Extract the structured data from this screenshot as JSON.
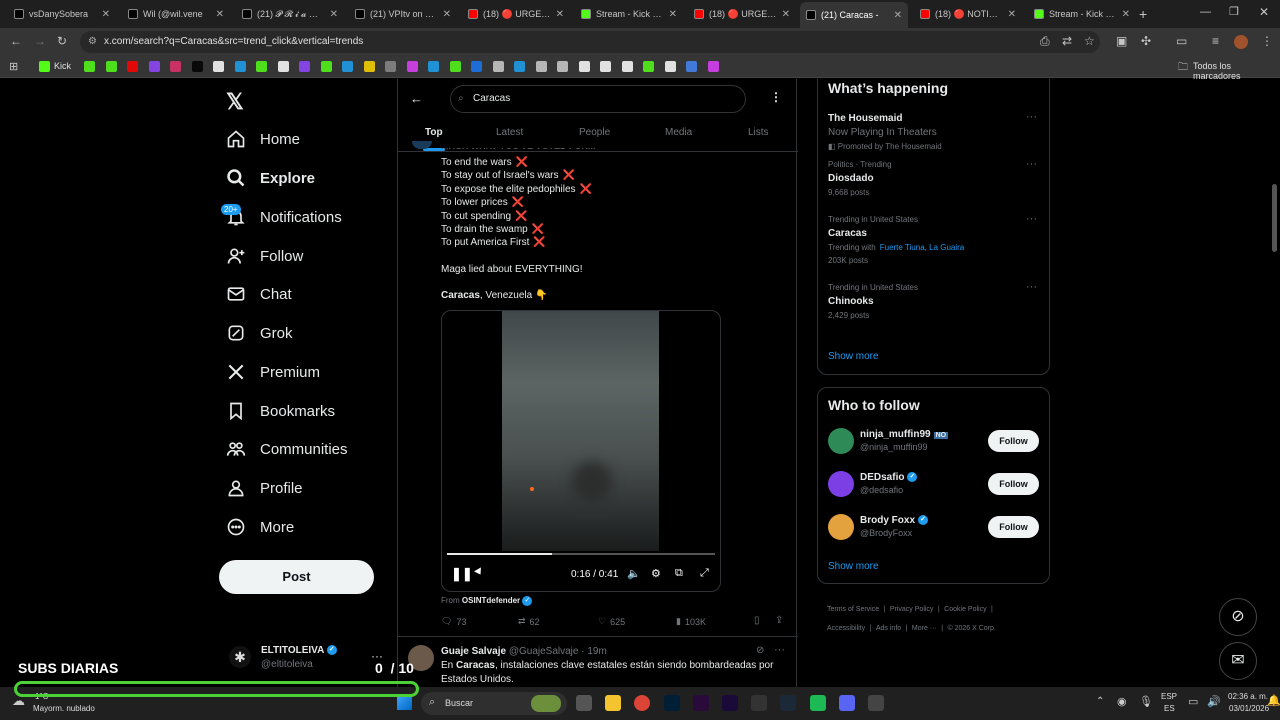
{
  "tabs": [
    {
      "title": "vsDanySobera",
      "color": "#000000",
      "icon": "tiktok-icon"
    },
    {
      "title": "Wil (@wil.vene",
      "color": "#000000",
      "icon": "tiktok-icon"
    },
    {
      "title": "(21) 𝓟 𝓡 𝓲 𝓪 ❤ on",
      "color": "#000000",
      "icon": "x-icon"
    },
    {
      "title": "(21) VPItv on X: \"A",
      "color": "#000000",
      "icon": "x-icon"
    },
    {
      "title": "(18) 🔴 URGENTE",
      "color": "#ff0000",
      "icon": "youtube-icon"
    },
    {
      "title": "Stream - Kick Dash",
      "color": "#53fc18",
      "icon": "kick-icon"
    },
    {
      "title": "(18) 🔴 URGENTE",
      "color": "#ff0000",
      "icon": "youtube-icon"
    },
    {
      "title": "(21) Caracas -",
      "color": "#000000",
      "icon": "x-icon",
      "active": true
    },
    {
      "title": "(18) 🔴 NOTICIAS",
      "color": "#ff0000",
      "icon": "youtube-icon"
    },
    {
      "title": "Stream - Kick Dash",
      "color": "#53fc18",
      "icon": "kick-icon"
    }
  ],
  "url": "x.com/search?q=Caracas&src=trend_click&vertical=trends",
  "bookmarks": {
    "first_label": "Kick",
    "all_bookmarks": "Todos los marcadores"
  },
  "nav": {
    "home": "Home",
    "explore": "Explore",
    "notifications": "Notifications",
    "notif_badge": "20+",
    "follow": "Follow",
    "chat": "Chat",
    "grok": "Grok",
    "premium": "Premium",
    "bookmarks": "Bookmarks",
    "communities": "Communities",
    "profile": "Profile",
    "more": "More",
    "post": "Post"
  },
  "account": {
    "name": "ELTITOLEIVA",
    "handle": "@eltitoleiva"
  },
  "search": {
    "value": "Caracas"
  },
  "search_tabs": [
    "Top",
    "Latest",
    "People",
    "Media",
    "Lists"
  ],
  "tweet": {
    "truncated_top": "MAGA WHAT YOU'VE VOTED FOR...",
    "lines": [
      "To end the wars",
      "To stay out of Israel's wars",
      "To expose the elite pedophiles",
      "To lower prices",
      "To cut spending",
      "To drain the swamp",
      "To put America First"
    ],
    "xmark": "❌",
    "maga_line": "Maga lied about EVERYTHING!",
    "location_bold": "Caracas",
    "location_rest": ", Venezuela 👇",
    "video_time": "0:16 / 0:41",
    "video_progress": 0.39,
    "from_label": "From",
    "from_account": "OSINTdefender",
    "replies": "73",
    "reposts": "62",
    "likes": "625",
    "views": "103K"
  },
  "next_tweet": {
    "name": "Guaje Salvaje",
    "handle": "@GuajeSalvaje",
    "time": "· 19m",
    "text_pre": "En ",
    "text_bold": "Caracas",
    "text_post": ", instalaciones clave estatales están siendo bombardeadas  por",
    "text_line2": "Estados Unidos."
  },
  "whats_happening": {
    "title": "What’s happening",
    "promo": {
      "name": "The Housemaid",
      "sub": "Now Playing In Theaters",
      "promoted": "Promoted by The Housemaid"
    },
    "trends": [
      {
        "category": "Politics · Trending",
        "name": "Diosdado",
        "meta": "9,668 posts"
      },
      {
        "category": "Trending in United States",
        "name": "Caracas",
        "with_label": "Trending with",
        "with_links": "Fuerte Tiuna, La Guaira",
        "meta": "203K posts"
      },
      {
        "category": "Trending in United States",
        "name": "Chinooks",
        "meta": "2,429 posts"
      }
    ],
    "show_more": "Show more"
  },
  "who_to_follow": {
    "title": "Who to follow",
    "users": [
      {
        "name": "ninja_muffin99",
        "tag": "NO",
        "handle": "@ninja_muffin99",
        "button": "Follow",
        "color": "#2e8b57"
      },
      {
        "name": "DEDsafio",
        "handle": "@dedsafio",
        "button": "Follow",
        "color": "#7b3fe4"
      },
      {
        "name": "Brody Foxx",
        "handle": "@BrodyFoxx",
        "button": "Follow",
        "color": "#e4a23f"
      }
    ],
    "show_more": "Show more"
  },
  "footer": {
    "links": [
      "Terms of Service",
      "Privacy Policy",
      "Cookie Policy",
      "Accessibility",
      "Ads info",
      "More ···"
    ],
    "copyright": "© 2026 X Corp."
  },
  "overlay": {
    "title": "SUBS DIARIAS",
    "count": "0",
    "goal": "/ 10"
  },
  "taskbar": {
    "weather_temp": "1°C",
    "weather": "Mayorm. nublado",
    "search_placeholder": "Buscar",
    "lang_top": "ESP",
    "lang_bottom": "ES",
    "time": "02:36 a. m.",
    "date": "03/01/2026"
  }
}
